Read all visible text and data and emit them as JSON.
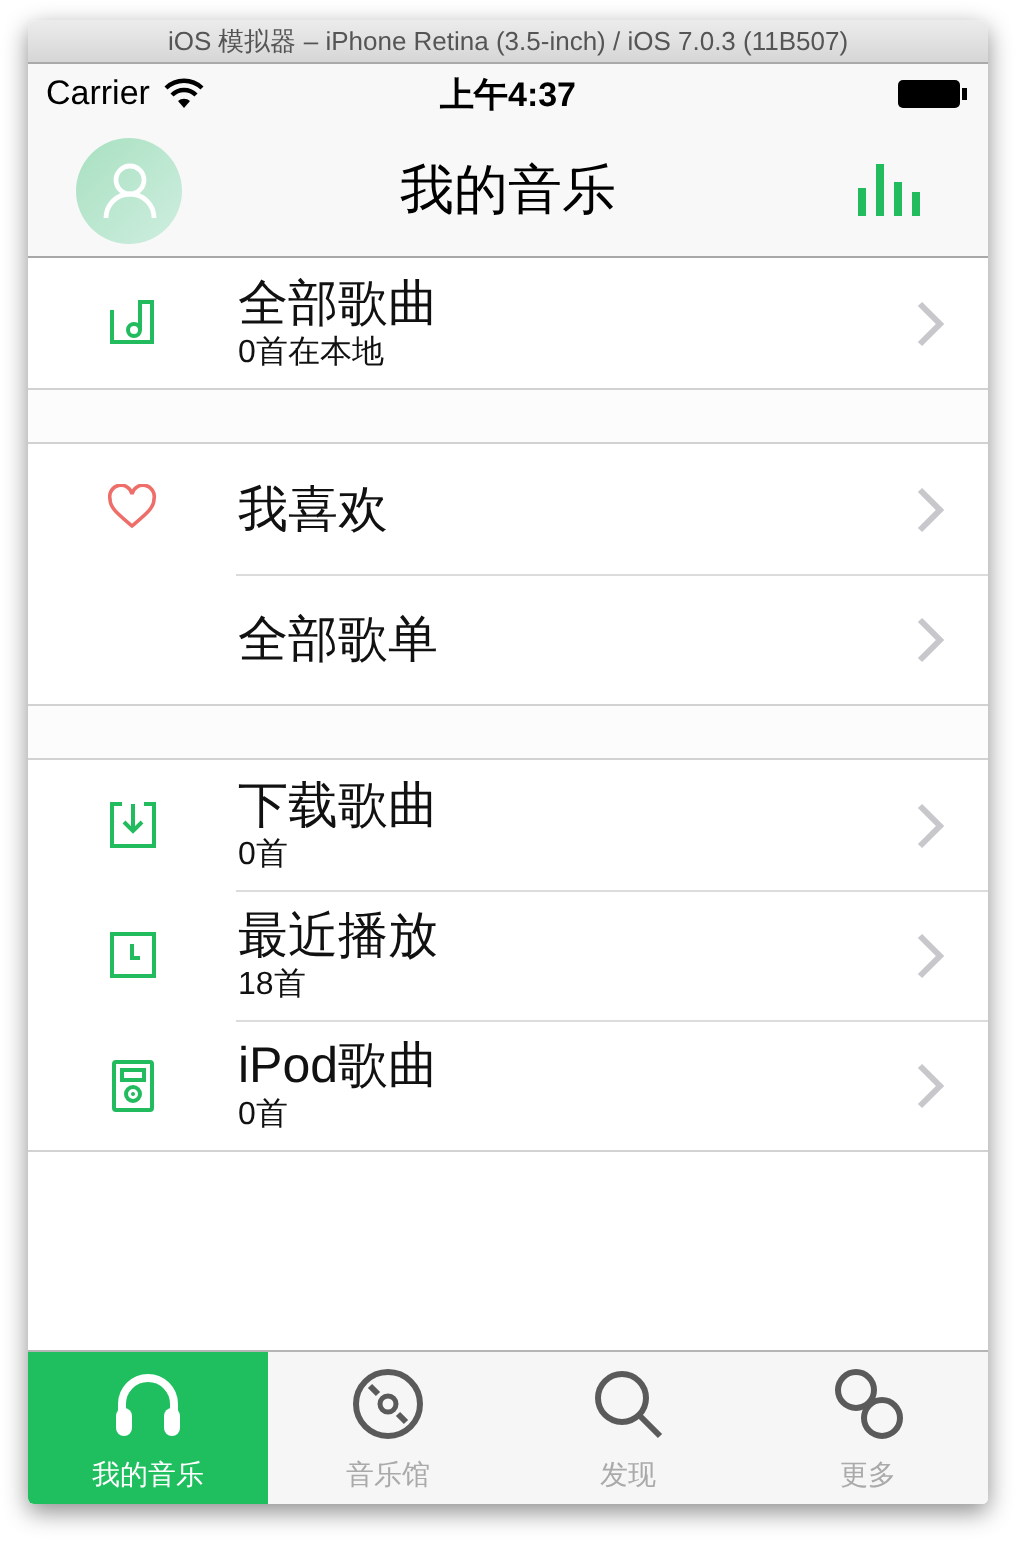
{
  "window": {
    "title": "iOS 模拟器 – iPhone Retina (3.5-inch) / iOS 7.0.3 (11B507)"
  },
  "status_bar": {
    "carrier": "Carrier",
    "time": "上午4:37"
  },
  "nav": {
    "title": "我的音乐"
  },
  "sections": [
    {
      "items": [
        {
          "title": "全部歌曲",
          "subtitle": "0首在本地"
        }
      ]
    },
    {
      "items": [
        {
          "title": "我喜欢"
        },
        {
          "title": "全部歌单"
        }
      ]
    },
    {
      "items": [
        {
          "title": "下载歌曲",
          "subtitle": "0首"
        },
        {
          "title": "最近播放",
          "subtitle": "18首"
        },
        {
          "title": "iPod歌曲",
          "subtitle": "0首"
        }
      ]
    }
  ],
  "tab_bar": [
    {
      "label": "我的音乐",
      "selected": true
    },
    {
      "label": "音乐馆",
      "selected": false
    },
    {
      "label": "发现",
      "selected": false
    },
    {
      "label": "更多",
      "selected": false
    }
  ]
}
